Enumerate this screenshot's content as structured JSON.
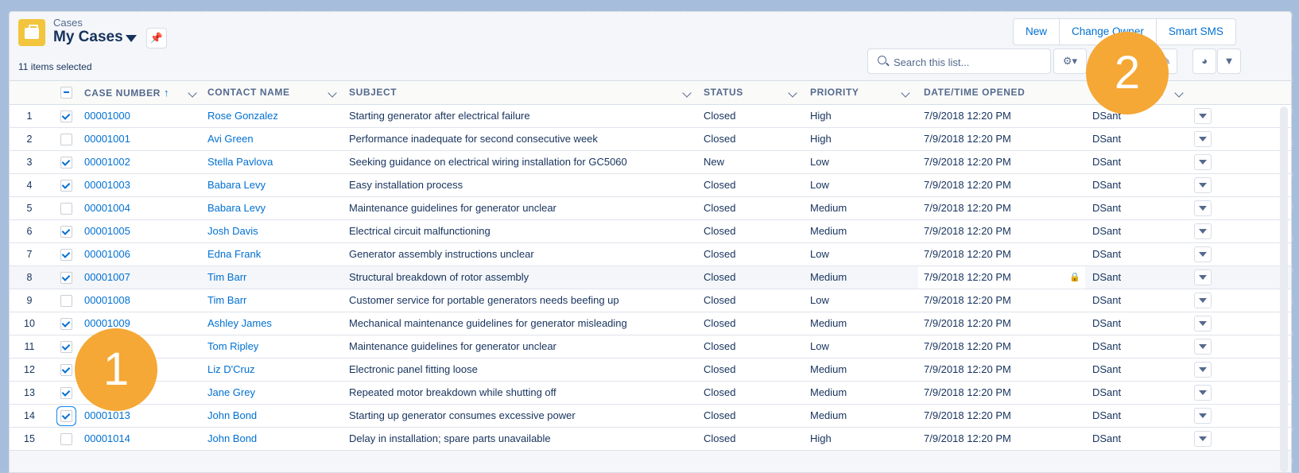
{
  "header": {
    "object_name": "Cases",
    "list_view_title": "My Cases",
    "items_selected": "11 items selected",
    "buttons": {
      "new": "New",
      "change_owner": "Change Owner",
      "smart_sms": "Smart SMS"
    },
    "search_placeholder": "Search this list..."
  },
  "columns": {
    "case_number": "CASE NUMBER",
    "contact_name": "CONTACT NAME",
    "subject": "SUBJECT",
    "status": "STATUS",
    "priority": "PRIORITY",
    "date_opened": "DATE/TIME OPENED",
    "owner_truncated": "..."
  },
  "rows": [
    {
      "num": "1",
      "case": "00001000",
      "contact": "Rose Gonzalez",
      "subject": "Starting generator after electrical failure",
      "status": "Closed",
      "priority": "High",
      "date": "7/9/2018 12:20 PM",
      "owner": "DSant",
      "checked": true
    },
    {
      "num": "2",
      "case": "00001001",
      "contact": "Avi Green",
      "subject": "Performance inadequate for second consecutive week",
      "status": "Closed",
      "priority": "High",
      "date": "7/9/2018 12:20 PM",
      "owner": "DSant",
      "checked": false
    },
    {
      "num": "3",
      "case": "00001002",
      "contact": "Stella Pavlova",
      "subject": "Seeking guidance on electrical wiring installation for GC5060",
      "status": "New",
      "priority": "Low",
      "date": "7/9/2018 12:20 PM",
      "owner": "DSant",
      "checked": true
    },
    {
      "num": "4",
      "case": "00001003",
      "contact": "Babara Levy",
      "subject": "Easy installation process",
      "status": "Closed",
      "priority": "Low",
      "date": "7/9/2018 12:20 PM",
      "owner": "DSant",
      "checked": true
    },
    {
      "num": "5",
      "case": "00001004",
      "contact": "Babara Levy",
      "subject": "Maintenance guidelines for generator unclear",
      "status": "Closed",
      "priority": "Medium",
      "date": "7/9/2018 12:20 PM",
      "owner": "DSant",
      "checked": false
    },
    {
      "num": "6",
      "case": "00001005",
      "contact": "Josh Davis",
      "subject": "Electrical circuit malfunctioning",
      "status": "Closed",
      "priority": "Medium",
      "date": "7/9/2018 12:20 PM",
      "owner": "DSant",
      "checked": true
    },
    {
      "num": "7",
      "case": "00001006",
      "contact": "Edna Frank",
      "subject": "Generator assembly instructions unclear",
      "status": "Closed",
      "priority": "Low",
      "date": "7/9/2018 12:20 PM",
      "owner": "DSant",
      "checked": true
    },
    {
      "num": "8",
      "case": "00001007",
      "contact": "Tim Barr",
      "subject": "Structural breakdown of rotor assembly",
      "status": "Closed",
      "priority": "Medium",
      "date": "7/9/2018 12:20 PM",
      "owner": "DSant",
      "checked": true
    },
    {
      "num": "9",
      "case": "00001008",
      "contact": "Tim Barr",
      "subject": "Customer service for portable generators needs beefing up",
      "status": "Closed",
      "priority": "Low",
      "date": "7/9/2018 12:20 PM",
      "owner": "DSant",
      "checked": false
    },
    {
      "num": "10",
      "case": "00001009",
      "contact": "Ashley James",
      "subject": "Mechanical maintenance guidelines for generator misleading",
      "status": "Closed",
      "priority": "Medium",
      "date": "7/9/2018 12:20 PM",
      "owner": "DSant",
      "checked": true
    },
    {
      "num": "11",
      "case": "",
      "contact": "Tom Ripley",
      "subject": "Maintenance guidelines for generator unclear",
      "status": "Closed",
      "priority": "Low",
      "date": "7/9/2018 12:20 PM",
      "owner": "DSant",
      "checked": true
    },
    {
      "num": "12",
      "case": "",
      "contact": "Liz D'Cruz",
      "subject": "Electronic panel fitting loose",
      "status": "Closed",
      "priority": "Medium",
      "date": "7/9/2018 12:20 PM",
      "owner": "DSant",
      "checked": true
    },
    {
      "num": "13",
      "case": "",
      "contact": "Jane Grey",
      "subject": "Repeated motor breakdown while shutting off",
      "status": "Closed",
      "priority": "Medium",
      "date": "7/9/2018 12:20 PM",
      "owner": "DSant",
      "checked": true
    },
    {
      "num": "14",
      "case": "00001013",
      "contact": "John Bond",
      "subject": "Starting up generator consumes excessive power",
      "status": "Closed",
      "priority": "Medium",
      "date": "7/9/2018 12:20 PM",
      "owner": "DSant",
      "checked": true
    },
    {
      "num": "15",
      "case": "00001014",
      "contact": "John Bond",
      "subject": "Delay in installation; spare parts unavailable",
      "status": "Closed",
      "priority": "High",
      "date": "7/9/2018 12:20 PM",
      "owner": "DSant",
      "checked": false
    }
  ],
  "callouts": {
    "one": "1",
    "two": "2"
  },
  "colors": {
    "link": "#0070d2",
    "callout": "#f5a835",
    "object_icon": "#f2c53d"
  },
  "icons": [
    "case-icon",
    "pin-icon",
    "search-icon",
    "settings-icon",
    "edit-icon",
    "chart-icon",
    "filter-icon",
    "lock-icon",
    "chevron-down-icon",
    "sort-up-icon"
  ]
}
